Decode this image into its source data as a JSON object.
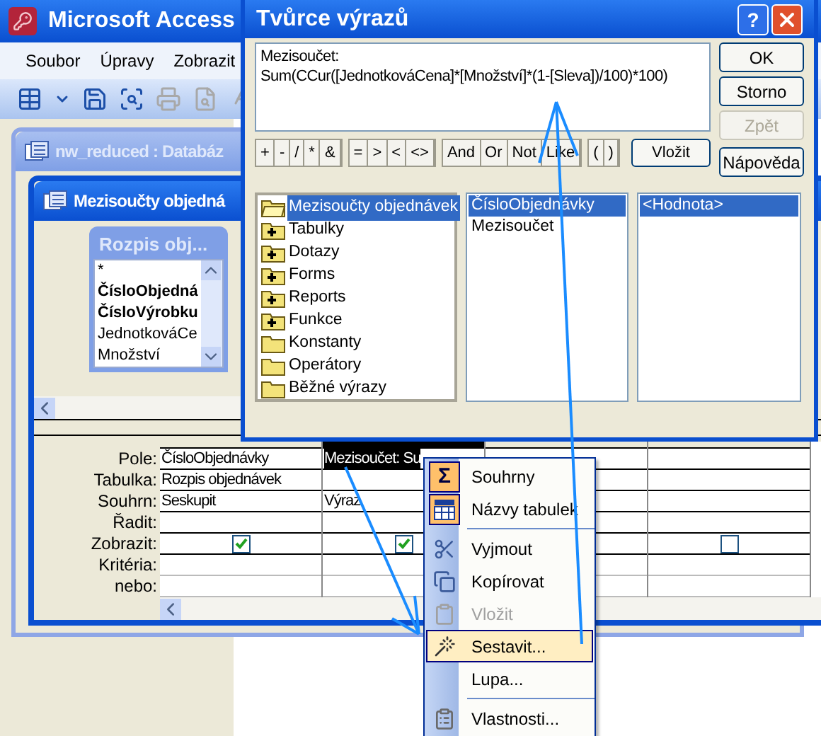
{
  "app": {
    "title": "Microsoft Access",
    "menu": [
      "Soubor",
      "Úpravy",
      "Zobrazit"
    ],
    "toolbar": [
      {
        "kind": "view",
        "disabled": false
      },
      {
        "kind": "dropdown",
        "disabled": false
      },
      {
        "kind": "save",
        "disabled": false
      },
      {
        "kind": "inspect",
        "disabled": false
      },
      {
        "kind": "print",
        "disabled": true
      },
      {
        "kind": "preview",
        "disabled": true
      },
      {
        "kind": "spelling",
        "disabled": true
      }
    ]
  },
  "db_window": {
    "title": "nw_reduced : Databáz"
  },
  "query_window": {
    "title": "Mezisoučty objedná",
    "table_box": {
      "title": "Rozpis obj...",
      "fields": [
        {
          "name": "*",
          "primary_key": false
        },
        {
          "name": "ČísloObjedná",
          "primary_key": true
        },
        {
          "name": "ČísloVýrobku",
          "primary_key": true
        },
        {
          "name": "JednotkováCe",
          "primary_key": false
        },
        {
          "name": "Množství",
          "primary_key": false
        }
      ]
    },
    "grid": {
      "row_labels": [
        "Pole:",
        "Tabulka:",
        "Souhrn:",
        "Řadit:",
        "Zobrazit:",
        "Kritéria:",
        "nebo:"
      ],
      "columns": [
        {
          "field": "ČísloObjednávky",
          "table": "Rozpis objednávek",
          "total": "Seskupit",
          "show": true,
          "selected": false
        },
        {
          "field": "Mezisoučet: Su",
          "total": "Výraz",
          "show": true,
          "selected": true
        },
        {
          "selected": false
        },
        {
          "show": false,
          "selected": false
        }
      ]
    }
  },
  "dialog": {
    "title": "Tvůrce výrazů",
    "help": "?",
    "expression": [
      "Mezisoučet:",
      "Sum(CCur([JednotkováCena]*[Množství]*(1-[Sleva])/100)*100)"
    ],
    "buttons": [
      {
        "label": "OK",
        "disabled": false
      },
      {
        "label": "Storno",
        "disabled": false
      },
      {
        "label": "Zpět",
        "disabled": true
      }
    ],
    "operator_groups": [
      [
        "+",
        "-",
        "/",
        "*",
        "&"
      ],
      [
        "=",
        ">",
        "<",
        "<>"
      ],
      [
        "And",
        "Or",
        "Not",
        "Like"
      ],
      [
        "(",
        ")"
      ]
    ],
    "paste_button": "Vložit",
    "help_button": "Nápověda",
    "folders": [
      {
        "label": "Mezisoučty objednávek",
        "kind": "open",
        "selected": true
      },
      {
        "label": "Tabulky",
        "kind": "plus",
        "selected": false
      },
      {
        "label": "Dotazy",
        "kind": "plus",
        "selected": false
      },
      {
        "label": "Forms",
        "kind": "plus",
        "selected": false
      },
      {
        "label": "Reports",
        "kind": "plus",
        "selected": false
      },
      {
        "label": "Funkce",
        "kind": "plus",
        "selected": false
      },
      {
        "label": "Konstanty",
        "kind": "plain",
        "selected": false
      },
      {
        "label": "Operátory",
        "kind": "plain",
        "selected": false
      },
      {
        "label": "Běžné výrazy",
        "kind": "plain",
        "selected": false
      }
    ],
    "fields": [
      {
        "label": "ČísloObjednávky",
        "selected": true
      },
      {
        "label": "Mezisoučet",
        "selected": false
      }
    ],
    "values": [
      {
        "label": "<Hodnota>",
        "selected": true
      }
    ]
  },
  "context_menu": [
    {
      "kind": "sigma",
      "glyph": "Σ",
      "label": "Souhrny",
      "checked": true,
      "disabled": false,
      "selected": false
    },
    {
      "kind": "table",
      "label": "Názvy tabulek",
      "checked": true,
      "disabled": false,
      "selected": false
    },
    {
      "kind": "separator"
    },
    {
      "kind": "cut",
      "label": "Vyjmout",
      "checked": false,
      "disabled": false,
      "selected": false
    },
    {
      "kind": "copy",
      "label": "Kopírovat",
      "checked": false,
      "disabled": false,
      "selected": false
    },
    {
      "kind": "paste",
      "label": "Vložit",
      "checked": false,
      "disabled": true,
      "selected": false
    },
    {
      "kind": "build",
      "label": "Sestavit...",
      "checked": false,
      "disabled": false,
      "selected": true
    },
    {
      "kind": "plain",
      "label": "Lupa...",
      "checked": false,
      "disabled": false,
      "selected": false
    },
    {
      "kind": "separator"
    },
    {
      "kind": "properties",
      "label": "Vlastnosti...",
      "checked": false,
      "disabled": false,
      "selected": false
    }
  ]
}
